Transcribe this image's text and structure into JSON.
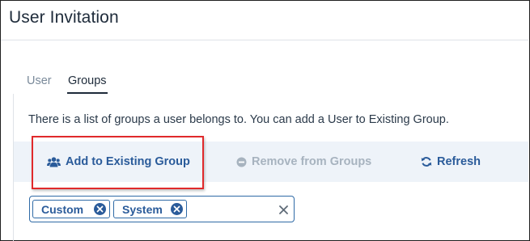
{
  "window": {
    "title": "User Invitation"
  },
  "tabs": [
    {
      "label": "User",
      "active": false
    },
    {
      "label": "Groups",
      "active": true
    }
  ],
  "description": "There is a list of groups a user belongs to. You can add a User to Existing Group.",
  "toolbar": {
    "add_label": "Add to Existing Group",
    "add_icon": "users-icon",
    "remove_label": "Remove from Groups",
    "remove_icon": "minus-circle-icon",
    "remove_enabled": false,
    "refresh_label": "Refresh",
    "refresh_icon": "refresh-icon"
  },
  "groups": {
    "selected": [
      {
        "label": "Custom"
      },
      {
        "label": "System"
      }
    ]
  },
  "colors": {
    "accent": "#2a5b9a",
    "highlight": "#e0292b",
    "toolbar_bg": "#eef3f9",
    "disabled": "#a7b3bf"
  }
}
